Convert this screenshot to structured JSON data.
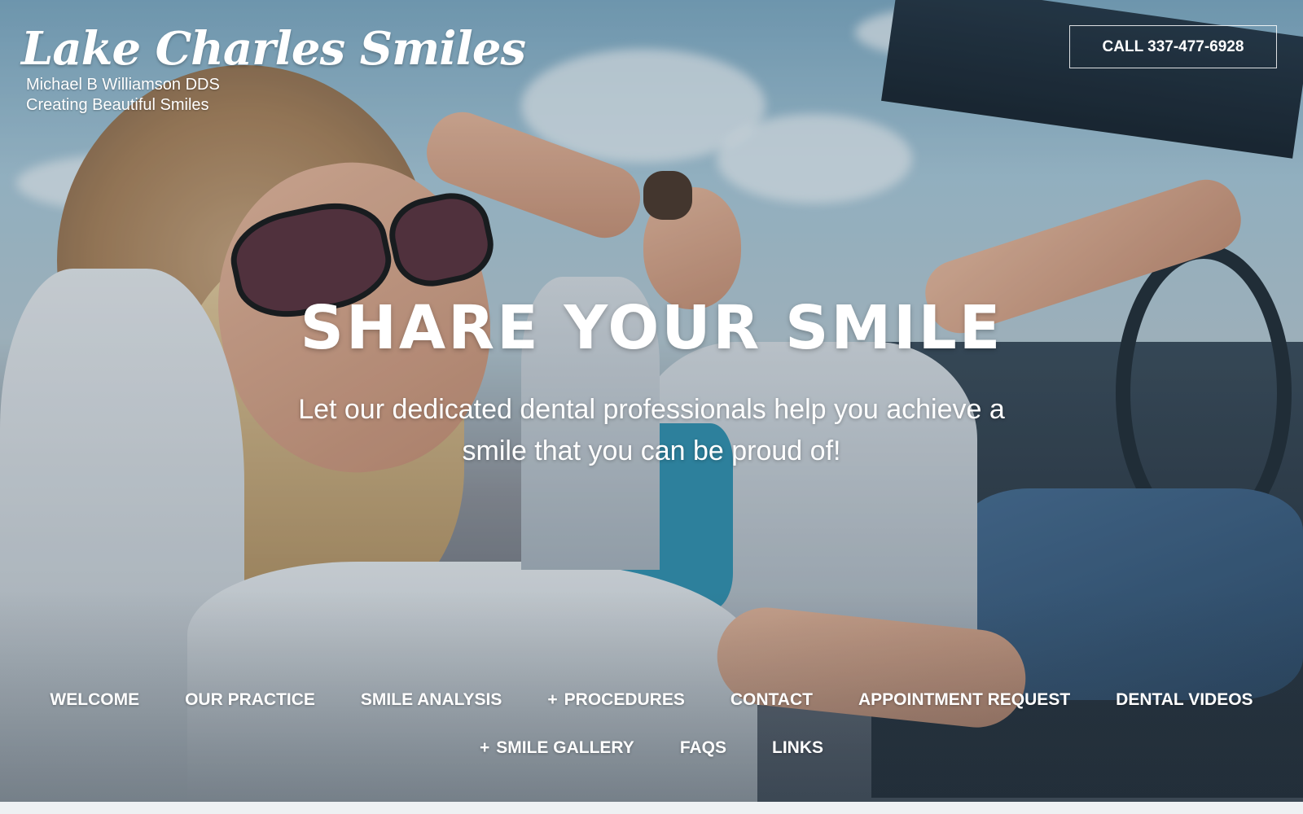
{
  "header": {
    "logo_title": "Lake Charles Smiles",
    "doctor": "Michael B Williamson DDS",
    "tagline": "Creating Beautiful Smiles",
    "call_button": "CALL 337-477-6928"
  },
  "hero": {
    "headline": "SHARE YOUR SMILE",
    "subheading": "Let our dedicated dental professionals help you achieve a smile that you can be proud of!",
    "background_image": "couple-in-convertible-car"
  },
  "nav": {
    "row1": [
      {
        "label": "WELCOME",
        "plus": ""
      },
      {
        "label": "OUR PRACTICE",
        "plus": ""
      },
      {
        "label": "SMILE ANALYSIS",
        "plus": ""
      },
      {
        "label": "PROCEDURES",
        "plus": "+"
      },
      {
        "label": "CONTACT",
        "plus": ""
      },
      {
        "label": "APPOINTMENT REQUEST",
        "plus": ""
      },
      {
        "label": "DENTAL VIDEOS",
        "plus": ""
      }
    ],
    "row2": [
      {
        "label": "SMILE GALLERY",
        "plus": "+"
      },
      {
        "label": "FAQS",
        "plus": ""
      },
      {
        "label": "LINKS",
        "plus": ""
      }
    ]
  },
  "colors": {
    "text": "#ffffff",
    "sky": "#7da9c2",
    "page_background": "#eef1f3"
  }
}
